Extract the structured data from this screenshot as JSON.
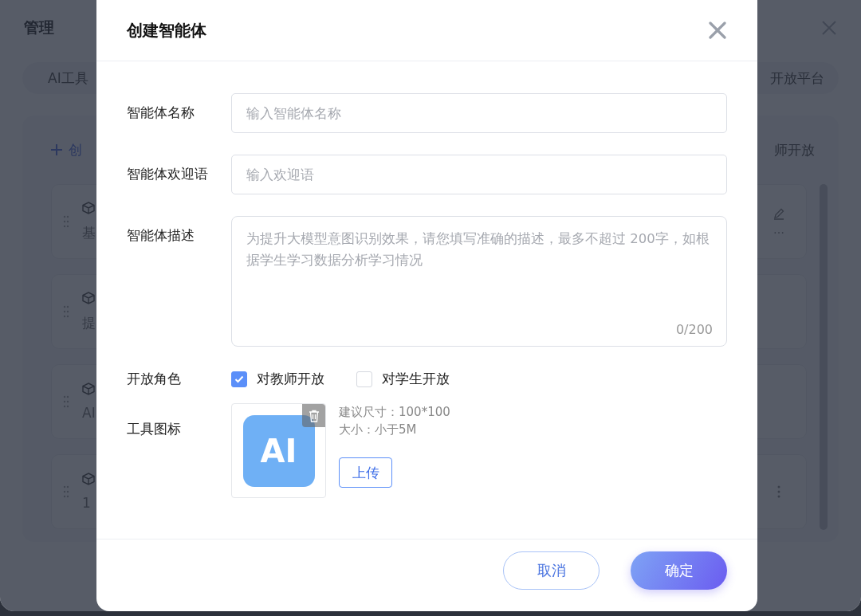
{
  "background": {
    "title": "管理",
    "tabs_left": "AI工具",
    "tabs_right": "开放平台",
    "create_link": "创",
    "filter_right": "师开放",
    "rows": [
      {
        "text": "基",
        "kind": "editable",
        "trail": "…"
      },
      {
        "text": "提",
        "kind": "plain"
      },
      {
        "text": "AI",
        "kind": "plain"
      },
      {
        "text": "1",
        "kind": "menu"
      }
    ]
  },
  "dialog": {
    "title": "创建智能体",
    "fields": [
      {
        "kind": "input",
        "label": "智能体名称",
        "placeholder": "输入智能体名称"
      },
      {
        "kind": "input",
        "label": "智能体欢迎语",
        "placeholder": "输入欢迎语"
      },
      {
        "kind": "textarea",
        "label": "智能体描述",
        "placeholder": "为提升大模型意图识别效果，请您填写准确的描述，最多不超过 200字，如根据学生学习数据分析学习情况",
        "counter": "0/200"
      }
    ],
    "roles": {
      "label": "开放角色",
      "options": [
        {
          "label": "对教师开放",
          "checked": true
        },
        {
          "label": "对学生开放",
          "checked": false
        }
      ]
    },
    "icon": {
      "label": "工具图标",
      "image_text": "AI",
      "hint_size": "建议尺寸：100*100",
      "hint_file": "大小：小于5M",
      "upload": "上传"
    },
    "buttons": [
      {
        "kind": "secondary",
        "label": "取消"
      },
      {
        "kind": "primary",
        "label": "确定"
      }
    ]
  }
}
